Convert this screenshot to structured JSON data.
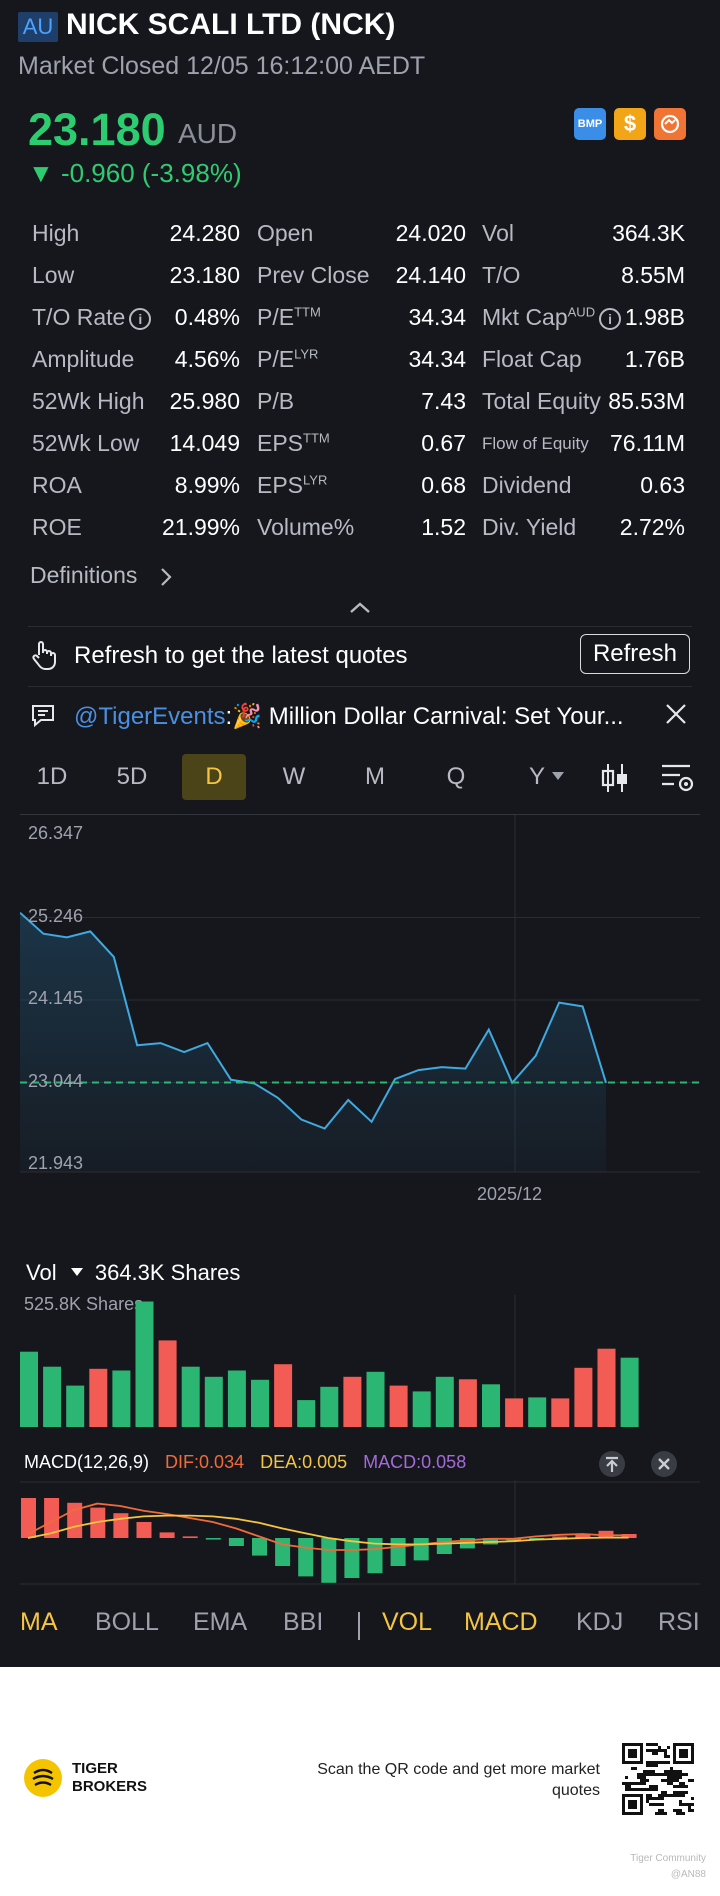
{
  "header": {
    "market_badge": "AU",
    "title": "NICK SCALI LTD (NCK)",
    "status": "Market Closed 12/05 16:12:00 AEDT",
    "price": "23.180",
    "currency": "AUD",
    "change": "▼ -0.960 (-3.98%)",
    "icons": [
      "bmp-icon",
      "dollar-icon",
      "exchange-icon"
    ],
    "bmp_label": "BMP",
    "dollar_label": "$"
  },
  "stats": {
    "col1": [
      {
        "label": "High",
        "value": "24.280"
      },
      {
        "label": "Low",
        "value": "23.180"
      },
      {
        "label": "T/O Rate",
        "value": "0.48%"
      },
      {
        "label": "Amplitude",
        "value": "4.56%"
      },
      {
        "label": "52Wk High",
        "value": "25.980"
      },
      {
        "label": "52Wk Low",
        "value": "14.049"
      },
      {
        "label": "ROA",
        "value": "8.99%"
      },
      {
        "label": "ROE",
        "value": "21.99%"
      }
    ],
    "col2": [
      {
        "label": "Open",
        "sup": "",
        "value": "24.020"
      },
      {
        "label": "Prev Close",
        "sup": "",
        "value": "24.140"
      },
      {
        "label": "P/E",
        "sup": "TTM",
        "value": "34.34"
      },
      {
        "label": "P/E",
        "sup": "LYR",
        "value": "34.34"
      },
      {
        "label": "P/B",
        "sup": "",
        "value": "7.43"
      },
      {
        "label": "EPS",
        "sup": "TTM",
        "value": "0.67"
      },
      {
        "label": "EPS",
        "sup": "LYR",
        "value": "0.68"
      },
      {
        "label": "Volume%",
        "sup": "",
        "value": "1.52"
      }
    ],
    "col3": [
      {
        "label": "Vol",
        "sup": "",
        "value": "364.3K"
      },
      {
        "label": "T/O",
        "sup": "",
        "value": "8.55M"
      },
      {
        "label": "Mkt Cap",
        "sup": "AUD",
        "value": "1.98B"
      },
      {
        "label": "Float Cap",
        "sup": "",
        "value": "1.76B"
      },
      {
        "label": "Total Equity",
        "sup": "",
        "value": "85.53M"
      },
      {
        "label": "Flow of Equity",
        "sup": "",
        "value": "76.11M"
      },
      {
        "label": "Dividend",
        "sup": "",
        "value": "0.63"
      },
      {
        "label": "Div. Yield",
        "sup": "",
        "value": "2.72%"
      }
    ],
    "info_glyph": "i"
  },
  "definitions_label": "Definitions",
  "refresh": {
    "text": "Refresh to get the latest quotes",
    "button": "Refresh"
  },
  "event": {
    "mention": "@TigerEvents",
    "text": ":🎉 Million Dollar Carnival: Set Your..."
  },
  "tabs": [
    "1D",
    "5D",
    "D",
    "W",
    "M",
    "Q",
    "Y"
  ],
  "active_tab": "D",
  "chart_data": [
    {
      "type": "line",
      "title": "",
      "y_ticks": [
        "26.347",
        "25.246",
        "24.145",
        "23.044",
        "21.943"
      ],
      "ylim": [
        21.943,
        26.347
      ],
      "x_labels": [
        "2025/12"
      ],
      "prev_close_line": 23.044,
      "y": [
        25.31,
        25.03,
        24.98,
        25.06,
        24.72,
        23.54,
        23.57,
        23.45,
        23.57,
        23.08,
        23.03,
        22.84,
        22.55,
        22.43,
        22.81,
        22.52,
        23.09,
        23.21,
        23.25,
        23.23,
        23.75,
        23.04,
        23.4,
        24.11,
        24.06,
        23.04
      ],
      "grid": true,
      "color": "#3fa9e0"
    },
    {
      "type": "bar",
      "title": "Vol",
      "value_label": "364.3K Shares",
      "max_label": "525.8K Shares",
      "ylim": [
        0,
        525.8
      ],
      "values": [
        300,
        240,
        165,
        232,
        225,
        500,
        345,
        240,
        200,
        225,
        188,
        250,
        107,
        160,
        200,
        220,
        165,
        142,
        200,
        190,
        170,
        114,
        118,
        114,
        236,
        312,
        276
      ],
      "colors": [
        "g",
        "g",
        "g",
        "r",
        "g",
        "g",
        "r",
        "g",
        "g",
        "g",
        "g",
        "r",
        "g",
        "g",
        "r",
        "g",
        "r",
        "g",
        "g",
        "r",
        "g",
        "r",
        "g",
        "r",
        "r",
        "r",
        "g"
      ]
    },
    {
      "type": "bar",
      "title": "MACD(12,26,9)",
      "dif_label": "DIF:0.034",
      "dea_label": "DEA:0.005",
      "macd_label": "MACD:0.058",
      "ylim": [
        -0.6,
        0.6
      ],
      "values": [
        0.5,
        0.5,
        0.44,
        0.38,
        0.31,
        0.2,
        0.07,
        0.02,
        -0.02,
        -0.1,
        -0.22,
        -0.35,
        -0.48,
        -0.56,
        -0.5,
        -0.44,
        -0.35,
        -0.28,
        -0.2,
        -0.13,
        -0.08,
        -0.03,
        -0.01,
        0.01,
        0.05,
        0.09,
        0.05
      ],
      "dif": [
        0.05,
        0.2,
        0.35,
        0.43,
        0.4,
        0.34,
        0.3,
        0.25,
        0.2,
        0.12,
        0.02,
        -0.08,
        -0.12,
        -0.15,
        -0.15,
        -0.14,
        -0.11,
        -0.08,
        -0.05,
        -0.03,
        -0.01,
        -0.01,
        0.02,
        0.04,
        0.05,
        0.034,
        0.034
      ],
      "dea": [
        0.0,
        0.06,
        0.14,
        0.2,
        0.24,
        0.27,
        0.28,
        0.28,
        0.27,
        0.24,
        0.19,
        0.12,
        0.06,
        0.0,
        -0.04,
        -0.07,
        -0.08,
        -0.08,
        -0.07,
        -0.06,
        -0.05,
        -0.04,
        -0.02,
        -0.01,
        0.0,
        0.005,
        0.005
      ]
    }
  ],
  "indicators": {
    "main": [
      "MA",
      "BOLL",
      "EMA",
      "BBI"
    ],
    "sub": [
      "VOL",
      "MACD",
      "KDJ",
      "RSI"
    ],
    "active": [
      "MA",
      "VOL",
      "MACD"
    ]
  },
  "colors": {
    "up": "#f25c54",
    "down": "#2bb673",
    "accent": "#f5c542",
    "line": "#3fa9e0",
    "dif": "#f06a3a",
    "dea": "#f5c542",
    "macd": "#a56ad9"
  },
  "footer": {
    "brand": "TIGER",
    "brand2": "BROKERS",
    "scan_text": "Scan the QR code and get more market quotes",
    "watermark1": "Tiger Community",
    "watermark2": "@AN88"
  }
}
